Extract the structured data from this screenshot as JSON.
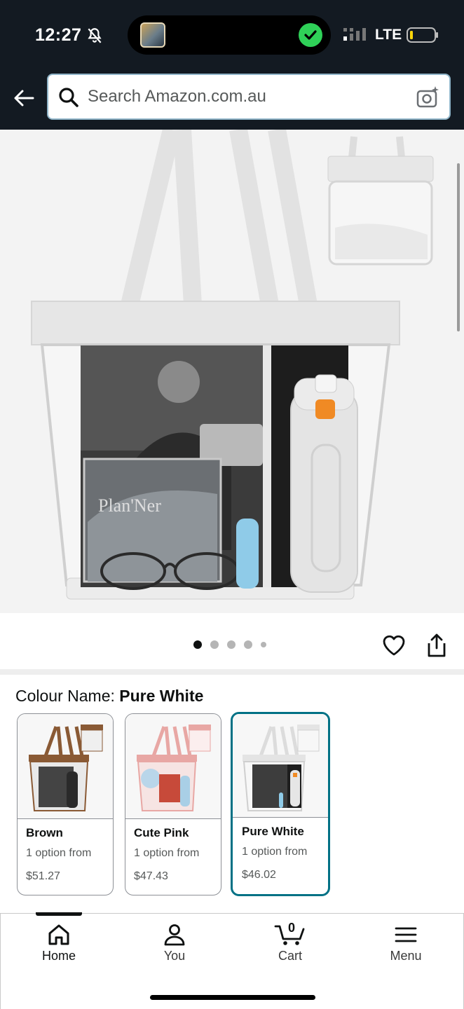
{
  "status_bar": {
    "time": "12:27",
    "network": "LTE",
    "icons": [
      "bell-muted-icon",
      "signal-icon",
      "battery-icon",
      "check-circle-icon"
    ]
  },
  "header": {
    "back_icon": "arrow-left-icon",
    "search_placeholder": "Search Amazon.com.au",
    "camera_icon": "camera-sparkle-icon"
  },
  "hero": {
    "image_description_icon": "product-photo",
    "carousel": {
      "count": 5,
      "active_index": 0
    },
    "actions": [
      "heart-icon",
      "share-icon"
    ]
  },
  "variations": {
    "label": "Colour Name:",
    "selected": "Pure White",
    "options": [
      {
        "name": "Brown",
        "availability": "1 option from",
        "price": "$51.27",
        "accent": "#8a5a35"
      },
      {
        "name": "Cute Pink",
        "availability": "1 option from",
        "price": "$47.43",
        "accent": "#e8a7a4"
      },
      {
        "name": "Pure White",
        "availability": "1 option from",
        "price": "$46.02",
        "accent": "#e2e2e2"
      }
    ],
    "selected_border_color": "#007185"
  },
  "bottom_nav": {
    "items": [
      {
        "label": "Home",
        "icon": "home-icon",
        "active": true
      },
      {
        "label": "You",
        "icon": "person-icon",
        "active": false
      },
      {
        "label": "Cart",
        "icon": "cart-icon",
        "active": false,
        "count": "0"
      },
      {
        "label": "Menu",
        "icon": "hamburger-menu-icon",
        "active": false
      }
    ]
  },
  "colors": {
    "header_bg": "#131a22",
    "accent_teal": "#007185",
    "text_primary": "#0f1111",
    "text_secondary": "#565959"
  }
}
